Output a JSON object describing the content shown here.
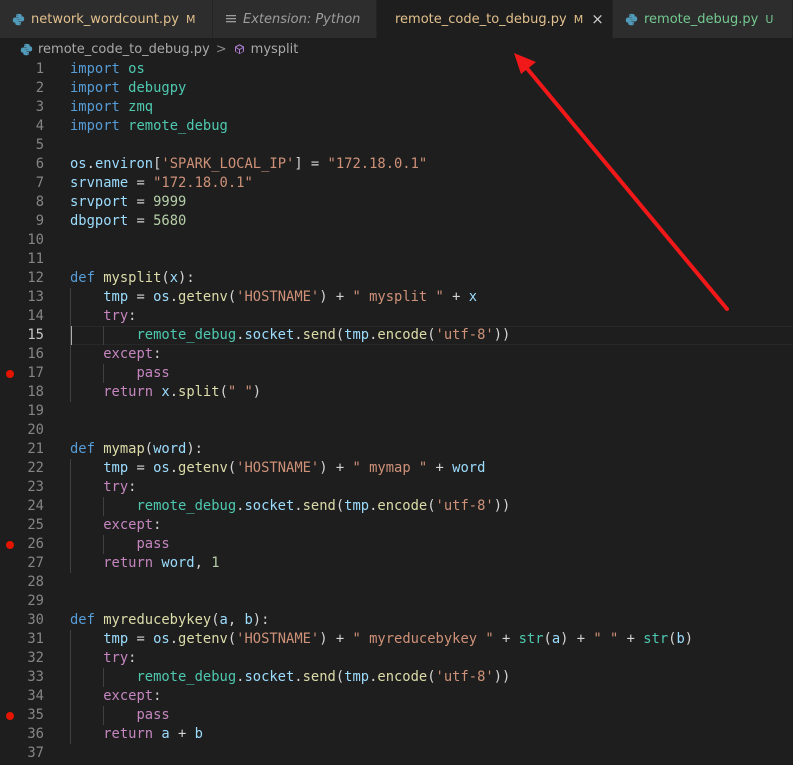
{
  "tabs": [
    {
      "label": "network_wordcount.py",
      "status": "M",
      "icon": "python-icon"
    },
    {
      "label": "Extension: Python",
      "status": "",
      "icon": "file-icon"
    },
    {
      "label": "remote_code_to_debug.py",
      "status": "M",
      "icon": "python-icon",
      "close": "×"
    },
    {
      "label": "remote_debug.py",
      "status": "U",
      "icon": "python-icon"
    }
  ],
  "breadcrumb": {
    "file": "remote_code_to_debug.py",
    "separator": ">",
    "symbol": "mysplit"
  },
  "editor": {
    "current_line": 15,
    "breakpoints": [
      17,
      26,
      35
    ],
    "line_numbers": [
      "1",
      "2",
      "3",
      "4",
      "5",
      "6",
      "7",
      "8",
      "9",
      "10",
      "11",
      "12",
      "13",
      "14",
      "15",
      "16",
      "17",
      "18",
      "19",
      "20",
      "21",
      "22",
      "23",
      "24",
      "25",
      "26",
      "27",
      "28",
      "29",
      "30",
      "31",
      "32",
      "33",
      "34",
      "35",
      "36",
      "37"
    ],
    "lines": [
      [
        [
          "kw",
          "import"
        ],
        [
          "pl",
          " "
        ],
        [
          "mod",
          "os"
        ]
      ],
      [
        [
          "kw",
          "import"
        ],
        [
          "pl",
          " "
        ],
        [
          "mod",
          "debugpy"
        ]
      ],
      [
        [
          "kw",
          "import"
        ],
        [
          "pl",
          " "
        ],
        [
          "mod",
          "zmq"
        ]
      ],
      [
        [
          "kw",
          "import"
        ],
        [
          "pl",
          " "
        ],
        [
          "mod",
          "remote_debug"
        ]
      ],
      [],
      [
        [
          "var",
          "os"
        ],
        [
          "pl",
          "."
        ],
        [
          "var",
          "environ"
        ],
        [
          "pl",
          "["
        ],
        [
          "str",
          "'SPARK_LOCAL_IP'"
        ],
        [
          "pl",
          "] = "
        ],
        [
          "str",
          "\"172.18.0.1\""
        ]
      ],
      [
        [
          "var",
          "srvname"
        ],
        [
          "pl",
          " = "
        ],
        [
          "str",
          "\"172.18.0.1\""
        ]
      ],
      [
        [
          "var",
          "srvport"
        ],
        [
          "pl",
          " = "
        ],
        [
          "num",
          "9999"
        ]
      ],
      [
        [
          "var",
          "dbgport"
        ],
        [
          "pl",
          " = "
        ],
        [
          "num",
          "5680"
        ]
      ],
      [],
      [],
      [
        [
          "kw",
          "def"
        ],
        [
          "pl",
          " "
        ],
        [
          "fn",
          "mysplit"
        ],
        [
          "pl",
          "("
        ],
        [
          "var",
          "x"
        ],
        [
          "pl",
          "):"
        ]
      ],
      [
        [
          "pl",
          "    "
        ],
        [
          "var",
          "tmp"
        ],
        [
          "pl",
          " = "
        ],
        [
          "var",
          "os"
        ],
        [
          "pl",
          "."
        ],
        [
          "fn",
          "getenv"
        ],
        [
          "pl",
          "("
        ],
        [
          "str",
          "'HOSTNAME'"
        ],
        [
          "pl",
          ") + "
        ],
        [
          "str",
          "\" mysplit \""
        ],
        [
          "pl",
          " + "
        ],
        [
          "var",
          "x"
        ]
      ],
      [
        [
          "pl",
          "    "
        ],
        [
          "ctl",
          "try"
        ],
        [
          "pl",
          ":"
        ]
      ],
      [
        [
          "pl",
          "        "
        ],
        [
          "mod",
          "remote_debug"
        ],
        [
          "pl",
          "."
        ],
        [
          "var",
          "socket"
        ],
        [
          "pl",
          "."
        ],
        [
          "fn",
          "send"
        ],
        [
          "pl",
          "("
        ],
        [
          "var",
          "tmp"
        ],
        [
          "pl",
          "."
        ],
        [
          "fn",
          "encode"
        ],
        [
          "pl",
          "("
        ],
        [
          "str",
          "'utf-8'"
        ],
        [
          "pl",
          "))"
        ]
      ],
      [
        [
          "pl",
          "    "
        ],
        [
          "ctl",
          "except"
        ],
        [
          "pl",
          ":"
        ]
      ],
      [
        [
          "pl",
          "        "
        ],
        [
          "ctl",
          "pass"
        ]
      ],
      [
        [
          "pl",
          "    "
        ],
        [
          "ctl",
          "return"
        ],
        [
          "pl",
          " "
        ],
        [
          "var",
          "x"
        ],
        [
          "pl",
          "."
        ],
        [
          "fn",
          "split"
        ],
        [
          "pl",
          "("
        ],
        [
          "str",
          "\" \""
        ],
        [
          "pl",
          ")"
        ]
      ],
      [],
      [],
      [
        [
          "kw",
          "def"
        ],
        [
          "pl",
          " "
        ],
        [
          "fn",
          "mymap"
        ],
        [
          "pl",
          "("
        ],
        [
          "var",
          "word"
        ],
        [
          "pl",
          "):"
        ]
      ],
      [
        [
          "pl",
          "    "
        ],
        [
          "var",
          "tmp"
        ],
        [
          "pl",
          " = "
        ],
        [
          "var",
          "os"
        ],
        [
          "pl",
          "."
        ],
        [
          "fn",
          "getenv"
        ],
        [
          "pl",
          "("
        ],
        [
          "str",
          "'HOSTNAME'"
        ],
        [
          "pl",
          ") + "
        ],
        [
          "str",
          "\" mymap \""
        ],
        [
          "pl",
          " + "
        ],
        [
          "var",
          "word"
        ]
      ],
      [
        [
          "pl",
          "    "
        ],
        [
          "ctl",
          "try"
        ],
        [
          "pl",
          ":"
        ]
      ],
      [
        [
          "pl",
          "        "
        ],
        [
          "mod",
          "remote_debug"
        ],
        [
          "pl",
          "."
        ],
        [
          "var",
          "socket"
        ],
        [
          "pl",
          "."
        ],
        [
          "fn",
          "send"
        ],
        [
          "pl",
          "("
        ],
        [
          "var",
          "tmp"
        ],
        [
          "pl",
          "."
        ],
        [
          "fn",
          "encode"
        ],
        [
          "pl",
          "("
        ],
        [
          "str",
          "'utf-8'"
        ],
        [
          "pl",
          "))"
        ]
      ],
      [
        [
          "pl",
          "    "
        ],
        [
          "ctl",
          "except"
        ],
        [
          "pl",
          ":"
        ]
      ],
      [
        [
          "pl",
          "        "
        ],
        [
          "ctl",
          "pass"
        ]
      ],
      [
        [
          "pl",
          "    "
        ],
        [
          "ctl",
          "return"
        ],
        [
          "pl",
          " "
        ],
        [
          "var",
          "word"
        ],
        [
          "pl",
          ", "
        ],
        [
          "num",
          "1"
        ]
      ],
      [],
      [],
      [
        [
          "kw",
          "def"
        ],
        [
          "pl",
          " "
        ],
        [
          "fn",
          "myreducebykey"
        ],
        [
          "pl",
          "("
        ],
        [
          "var",
          "a"
        ],
        [
          "pl",
          ", "
        ],
        [
          "var",
          "b"
        ],
        [
          "pl",
          "):"
        ]
      ],
      [
        [
          "pl",
          "    "
        ],
        [
          "var",
          "tmp"
        ],
        [
          "pl",
          " = "
        ],
        [
          "var",
          "os"
        ],
        [
          "pl",
          "."
        ],
        [
          "fn",
          "getenv"
        ],
        [
          "pl",
          "("
        ],
        [
          "str",
          "'HOSTNAME'"
        ],
        [
          "pl",
          ") + "
        ],
        [
          "str",
          "\" myreducebykey \""
        ],
        [
          "pl",
          " + "
        ],
        [
          "mod",
          "str"
        ],
        [
          "pl",
          "("
        ],
        [
          "var",
          "a"
        ],
        [
          "pl",
          ") + "
        ],
        [
          "str",
          "\" \""
        ],
        [
          "pl",
          " + "
        ],
        [
          "mod",
          "str"
        ],
        [
          "pl",
          "("
        ],
        [
          "var",
          "b"
        ],
        [
          "pl",
          ")"
        ]
      ],
      [
        [
          "pl",
          "    "
        ],
        [
          "ctl",
          "try"
        ],
        [
          "pl",
          ":"
        ]
      ],
      [
        [
          "pl",
          "        "
        ],
        [
          "mod",
          "remote_debug"
        ],
        [
          "pl",
          "."
        ],
        [
          "var",
          "socket"
        ],
        [
          "pl",
          "."
        ],
        [
          "fn",
          "send"
        ],
        [
          "pl",
          "("
        ],
        [
          "var",
          "tmp"
        ],
        [
          "pl",
          "."
        ],
        [
          "fn",
          "encode"
        ],
        [
          "pl",
          "("
        ],
        [
          "str",
          "'utf-8'"
        ],
        [
          "pl",
          "))"
        ]
      ],
      [
        [
          "pl",
          "    "
        ],
        [
          "ctl",
          "except"
        ],
        [
          "pl",
          ":"
        ]
      ],
      [
        [
          "pl",
          "        "
        ],
        [
          "ctl",
          "pass"
        ]
      ],
      [
        [
          "pl",
          "    "
        ],
        [
          "ctl",
          "return"
        ],
        [
          "pl",
          " "
        ],
        [
          "var",
          "a"
        ],
        [
          "pl",
          " + "
        ],
        [
          "var",
          "b"
        ]
      ],
      []
    ]
  },
  "colors": {
    "accent_arrow": "#f01818",
    "modified": "#e2c08d",
    "untracked": "#73c991",
    "breakpoint": "#e51400"
  }
}
